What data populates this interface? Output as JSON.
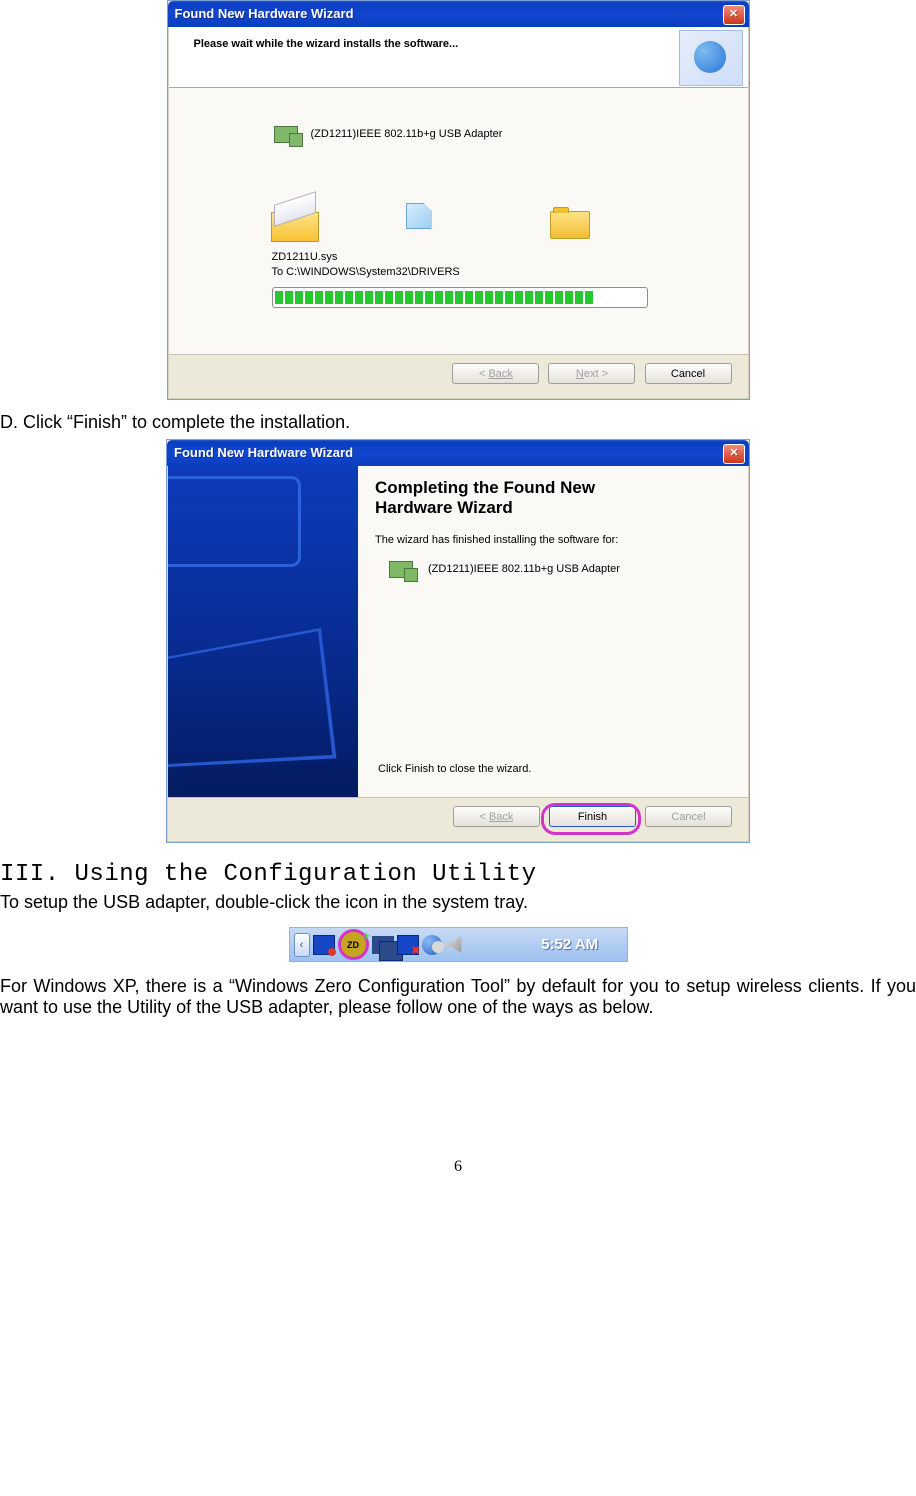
{
  "dlg1": {
    "title": "Found New Hardware Wizard",
    "header": "Please wait while the wizard installs the software...",
    "device": "(ZD1211)IEEE 802.11b+g USB Adapter",
    "file": "ZD1211U.sys",
    "destination": "To C:\\WINDOWS\\System32\\DRIVERS",
    "buttons": {
      "back": "Back",
      "next": "Next >",
      "cancel": "Cancel"
    }
  },
  "stepD": "D. Click “Finish” to complete the installation.",
  "dlg2": {
    "title": "Found New Hardware Wizard",
    "heading": "Completing the Found New Hardware Wizard",
    "sub": "The wizard has finished installing the software for:",
    "device": "(ZD1211)IEEE 802.11b+g USB Adapter",
    "tip": "Click Finish to close the wizard.",
    "buttons": {
      "back": "Back",
      "finish": "Finish",
      "cancel": "Cancel"
    }
  },
  "section3": {
    "title": "III. Using the Configuration Utility",
    "intro": "To setup the USB adapter, double-click the icon in the system tray."
  },
  "tray": {
    "zdLabel": "ZD",
    "time": "5:52 AM"
  },
  "para_zero": "For Windows XP, there is a “Windows Zero Configuration Tool” by default for you to setup wireless clients. If you want to use the Utility of the USB adapter, please follow one of the ways as below.",
  "pageNumber": "6"
}
